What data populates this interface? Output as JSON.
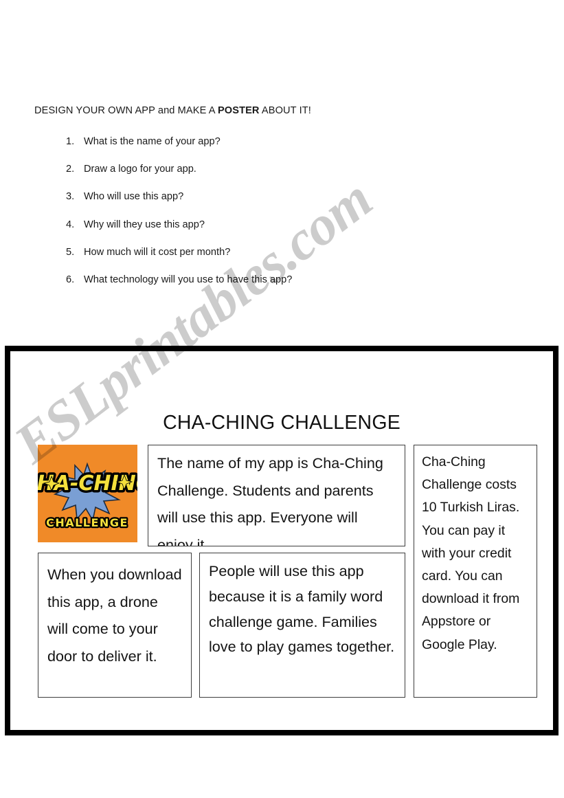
{
  "worksheet": {
    "title_prefix": "DESIGN YOUR OWN APP and MAKE A ",
    "title_bold": "POSTER",
    "title_suffix": " ABOUT IT!",
    "questions": [
      {
        "number": "1.",
        "text": "What is the name of your app?"
      },
      {
        "number": "2.",
        "text": "Draw a logo for your app."
      },
      {
        "number": "3.",
        "text": "Who will use this app?"
      },
      {
        "number": "4.",
        "text": "Why will they use this app?"
      },
      {
        "number": "5.",
        "text": "How much will it cost per month?"
      },
      {
        "number": "6.",
        "text": "What technology will you use to have this app?"
      }
    ]
  },
  "poster": {
    "title": "CHA-CHING CHALLENGE",
    "logo": {
      "background_color": "#f08a28",
      "word_top": "CHA-CHING",
      "word_bottom": "CHALLENGE",
      "letter_color": "#f5e03c",
      "outline_color": "#000000",
      "burst_color": "#7a9fd4"
    },
    "boxes": {
      "name": "The name of my app is Cha-Ching Challenge. Students and parents will use this app. Everyone will enjoy it.",
      "cost": "Cha-Ching Challenge costs 10 Turkish Liras. You can pay it with your credit card. You can download it from Appstore or Google Play.",
      "drone": "When you download this app, a drone will come to your door to deliver it.",
      "reason": "People will use this app because it is a family word challenge game. Families love to play games together."
    }
  },
  "watermark": {
    "text": "ESLprintables.com",
    "color": "rgba(0,0,0,0.20)"
  }
}
